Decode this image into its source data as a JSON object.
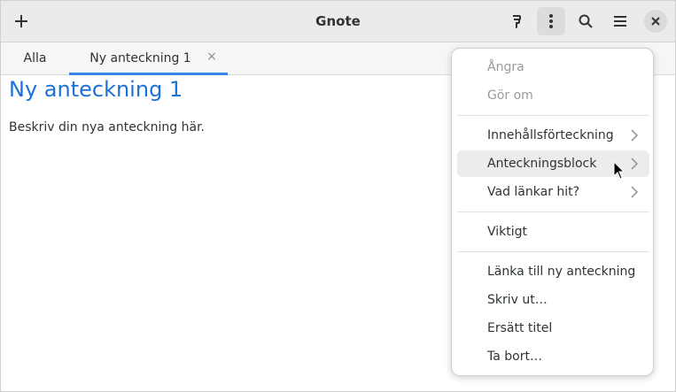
{
  "header": {
    "title": "Gnote"
  },
  "tabs": [
    {
      "label": "Alla"
    },
    {
      "label": "Ny anteckning 1",
      "close": "×"
    }
  ],
  "note": {
    "title": "Ny anteckning 1",
    "body": "Beskriv din nya anteckning här."
  },
  "menu": {
    "items": [
      {
        "label": "Ångra"
      },
      {
        "label": "Gör om"
      },
      {
        "label": "Innehållsförteckning"
      },
      {
        "label": "Anteckningsblock"
      },
      {
        "label": "Vad länkar hit?"
      },
      {
        "label": "Viktigt"
      },
      {
        "label": "Länka till ny anteckning"
      },
      {
        "label": "Skriv ut…"
      },
      {
        "label": "Ersätt titel"
      },
      {
        "label": "Ta bort…"
      }
    ]
  },
  "colors": {
    "accent": "#3584e4",
    "title": "#1c71d8"
  }
}
